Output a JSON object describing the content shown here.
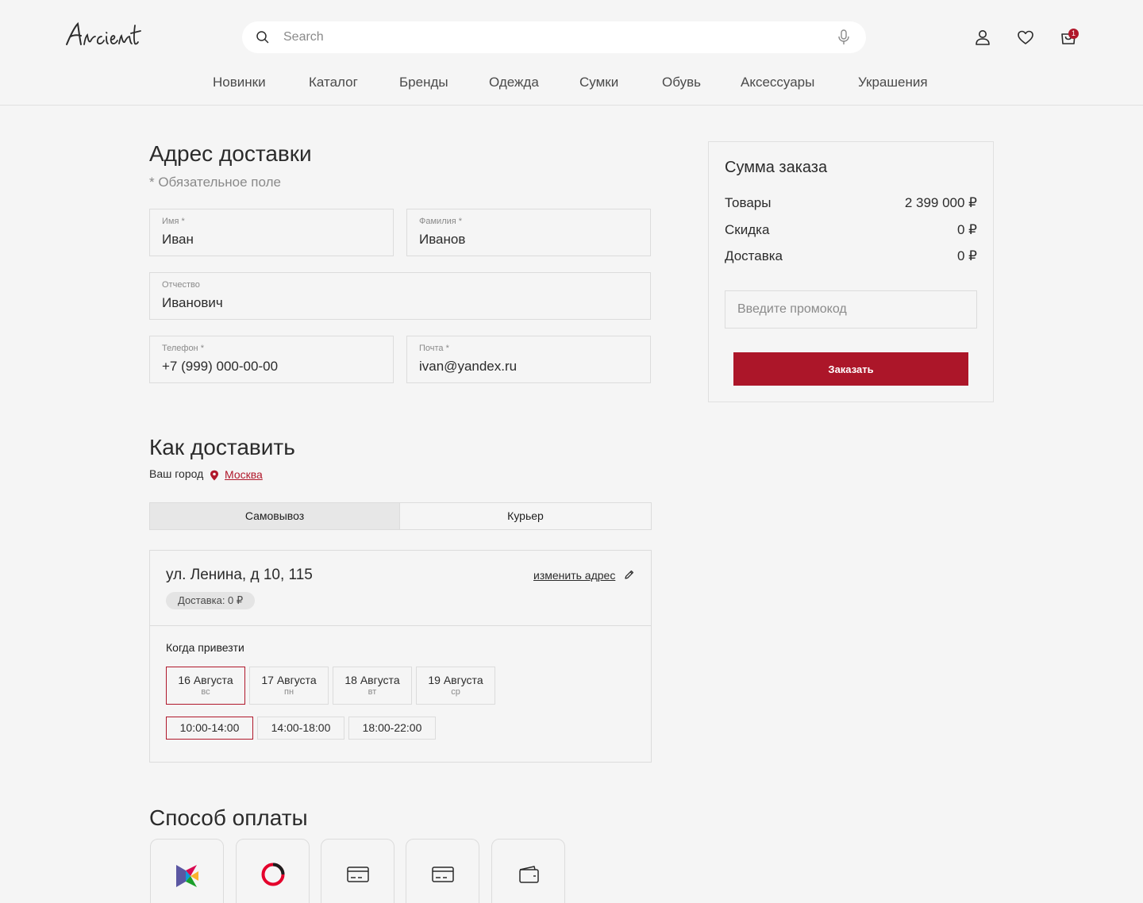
{
  "header": {
    "logo_text": "Ancient",
    "search_placeholder": "Search",
    "cart_count": "1",
    "nav": [
      "Новинки",
      "Каталог",
      "Бренды",
      "Одежда",
      "Сумки",
      "Обувь",
      "Аксессуары",
      "Украшения"
    ]
  },
  "address": {
    "title": "Адрес доставки",
    "required_note": "* Обязательное поле",
    "fields": {
      "first_name": {
        "label": "Имя *",
        "value": "Иван"
      },
      "last_name": {
        "label": "Фамилия *",
        "value": "Иванов"
      },
      "patronymic": {
        "label": "Отчество",
        "value": "Иванович"
      },
      "phone": {
        "label": "Телефон *",
        "value": "+7 (999) 000-00-00"
      },
      "email": {
        "label": "Почта *",
        "value": "ivan@yandex.ru"
      }
    }
  },
  "delivery": {
    "title": "Как доставить",
    "city_label": "Ваш город",
    "city": "Москва",
    "tabs": [
      "Самовывоз",
      "Курьер"
    ],
    "active_tab": "Самовывоз",
    "address_line": "ул. Ленина, д 10, 115",
    "delivery_cost": "Доставка: 0 ₽",
    "change_address": "изменить адрес",
    "when_label": "Когда привезти",
    "dates": [
      {
        "date": "16 Августа",
        "weekday": "вс"
      },
      {
        "date": "17 Августа",
        "weekday": "пн"
      },
      {
        "date": "18 Августа",
        "weekday": "вт"
      },
      {
        "date": "19 Августа",
        "weekday": "ср"
      }
    ],
    "selected_date": "16 Августа",
    "slots": [
      "10:00-14:00",
      "14:00-18:00",
      "18:00-22:00"
    ],
    "selected_slot": "10:00-14:00"
  },
  "payment": {
    "title": "Способ оплаты",
    "methods": [
      "sbp-icon",
      "ring-icon",
      "card-icon",
      "card-icon",
      "wallet-icon"
    ]
  },
  "summary": {
    "title": "Сумма заказа",
    "rows": [
      {
        "label": "Товары",
        "value": "2 399 000 ₽"
      },
      {
        "label": "Скидка",
        "value": "0 ₽"
      },
      {
        "label": "Доставка",
        "value": "0 ₽"
      }
    ],
    "promo_placeholder": "Введите промокод",
    "order_button": "Заказать"
  },
  "colors": {
    "accent": "#b0182b",
    "background": "#f5f5f5",
    "border": "#dcdcdc"
  }
}
